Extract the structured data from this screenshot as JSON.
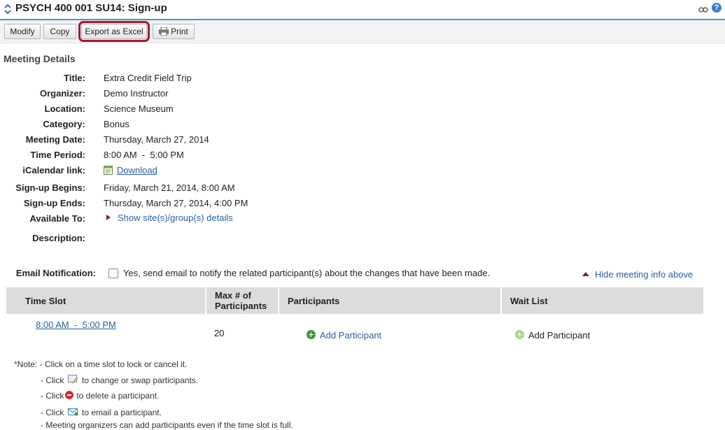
{
  "header": {
    "title": "PSYCH 400 001 SU14: Sign-up",
    "icons": [
      "reorder-arrows-icon",
      "link-icon",
      "help-icon"
    ]
  },
  "toolbar": {
    "modify_label": "Modify",
    "copy_label": "Copy",
    "export_label": "Export as Excel",
    "print_label": "Print"
  },
  "meeting": {
    "section_title": "Meeting Details",
    "fields": [
      {
        "label": "Title:",
        "value": "Extra Credit Field Trip"
      },
      {
        "label": "Organizer:",
        "value": "Demo Instructor"
      },
      {
        "label": "Location:",
        "value": "Science Museum"
      },
      {
        "label": "Category:",
        "value": "Bonus"
      },
      {
        "label": "Meeting Date:",
        "value": "Thursday, March 27, 2014"
      },
      {
        "label": "Time Period:",
        "value": "8:00 AM  -  5:00 PM"
      },
      {
        "label": "iCalendar link:",
        "value": "Download"
      },
      {
        "label": "Sign-up Begins:",
        "value": "Friday, March 21, 2014, 8:00 AM"
      },
      {
        "label": "Sign-up Ends:",
        "value": "Thursday, March 27, 2014, 4:00 PM"
      },
      {
        "label": "Available To:",
        "value": "Show site(s)/group(s) details"
      },
      {
        "label": "Description:",
        "value": ""
      }
    ]
  },
  "notification": {
    "label": "Email Notification:",
    "checkbox_text": "Yes, send email to notify the related participant(s) about the changes that have been made.",
    "checked": false,
    "hide_link": "Hide meeting info above"
  },
  "table": {
    "headers": [
      "Time Slot",
      "Max # of Participants",
      "Participants",
      "Wait List"
    ],
    "rows": [
      {
        "time_slot": "8:00 AM  -  5:00 PM",
        "max": "20",
        "participants_action": "Add Participant",
        "waitlist_action": "Add Participant"
      }
    ]
  },
  "notes": {
    "star": "*",
    "line1": "Note: - Click on a time slot to lock or cancel it.",
    "line2_pre": "- Click",
    "line2_post": "to change or swap participants.",
    "line3_pre": "- Click",
    "line3_post": "to delete a participant.",
    "line4_pre": "- Click",
    "line4_post": "to email a participant.",
    "line5": "- Meeting organizers can add participants even if the time slot is full."
  },
  "colors": {
    "accent_blue": "#4a90d9",
    "highlight_ring": "#a31d22",
    "link": "#2a5ea8"
  }
}
